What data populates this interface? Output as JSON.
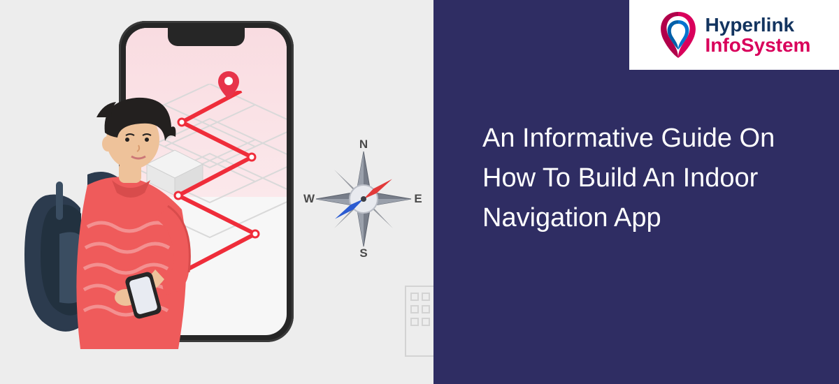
{
  "logo": {
    "word1": "Hyperlink",
    "word2": "InfoSystem",
    "mark_colors": {
      "outer": "#d9005b",
      "inner": "#0073cf"
    }
  },
  "heading": "An Informative Guide On How To Build An Indoor Navigation App",
  "colors": {
    "panel_bg": "#2f2d63",
    "left_bg": "#ededed",
    "route": "#ef2d3a",
    "pin": "#e7344a",
    "phone": "#262626",
    "compass_body": "#6b6f78",
    "compass_needle_red": "#e23a3a",
    "compass_needle_blue": "#2b5bd1",
    "shirt": "#ef5b5b",
    "backpack": "#2c3b4e",
    "skin": "#eec29a",
    "hair": "#23201f"
  },
  "compass": {
    "n": "N",
    "s": "S",
    "e": "E",
    "w": "W"
  },
  "illustration": {
    "phone_name": "phone-device",
    "map_name": "map-route",
    "pin_name": "location-pin",
    "compass_name": "compass-rose",
    "person_name": "person-with-backpack",
    "buildings_name": "city-buildings"
  }
}
